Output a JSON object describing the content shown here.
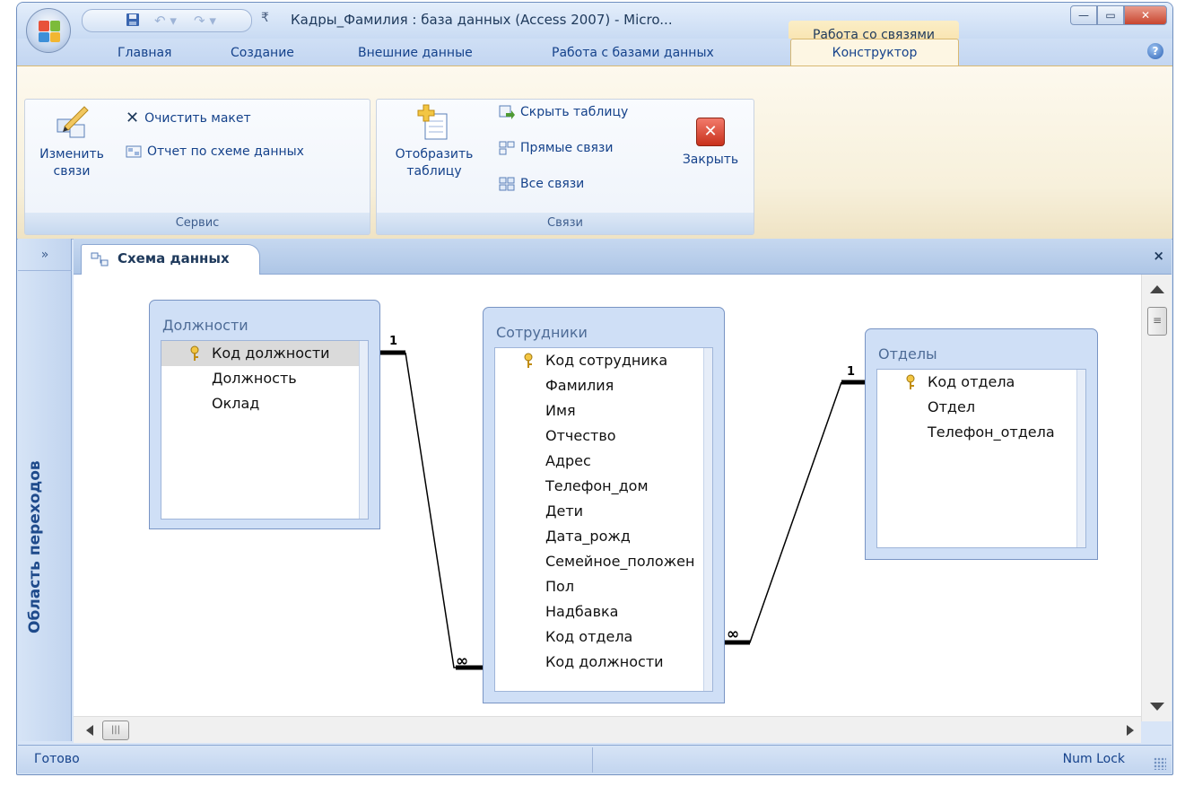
{
  "window": {
    "title": "Кадры_Фамилия : база данных (Access 2007) - Micro...",
    "context_tab": "Работа со связями"
  },
  "tabs": [
    {
      "label": "Главная"
    },
    {
      "label": "Создание"
    },
    {
      "label": "Внешние данные"
    },
    {
      "label": "Работа с базами данных"
    },
    {
      "label": "Конструктор"
    }
  ],
  "ribbon": {
    "servis": {
      "label": "Сервис",
      "edit_relations": "Изменить связи",
      "clear_layout": "Очистить макет",
      "report": "Отчет по схеме данных"
    },
    "svyazi": {
      "label": "Связи",
      "show_table": "Отобразить таблицу",
      "hide_table": "Скрыть таблицу",
      "direct_relations": "Прямые связи",
      "all_relations": "Все связи",
      "close": "Закрыть"
    }
  },
  "nav_pane": {
    "title": "Область переходов",
    "toggle": "»"
  },
  "document": {
    "tab_label": "Схема данных",
    "close": "×"
  },
  "tables": [
    {
      "name": "Должности",
      "fields": [
        "Код должности",
        "Должность",
        "Оклад"
      ],
      "key": "Код должности"
    },
    {
      "name": "Сотрудники",
      "fields": [
        "Код сотрудника",
        "Фамилия",
        "Имя",
        "Отчество",
        "Адрес",
        "Телефон_дом",
        "Дети",
        "Дата_рожд",
        "Семейное_положен",
        "Пол",
        "Надбавка",
        "Код отдела",
        "Код должности"
      ],
      "key": "Код сотрудника"
    },
    {
      "name": "Отделы",
      "fields": [
        "Код отдела",
        "Отдел",
        "Телефон_отдела"
      ],
      "key": "Код отдела"
    }
  ],
  "relations": [
    {
      "from": "Должности.Код должности",
      "to": "Сотрудники.Код должности",
      "one": "1",
      "many": "∞"
    },
    {
      "from": "Отделы.Код отдела",
      "to": "Сотрудники.Код отдела",
      "one": "1",
      "many": "∞"
    }
  ],
  "status": {
    "left": "Готово",
    "right": "Num Lock"
  },
  "colors": {
    "accent": "#15428b",
    "context_tab": "#f7dda0",
    "close_button": "#c8452f"
  }
}
